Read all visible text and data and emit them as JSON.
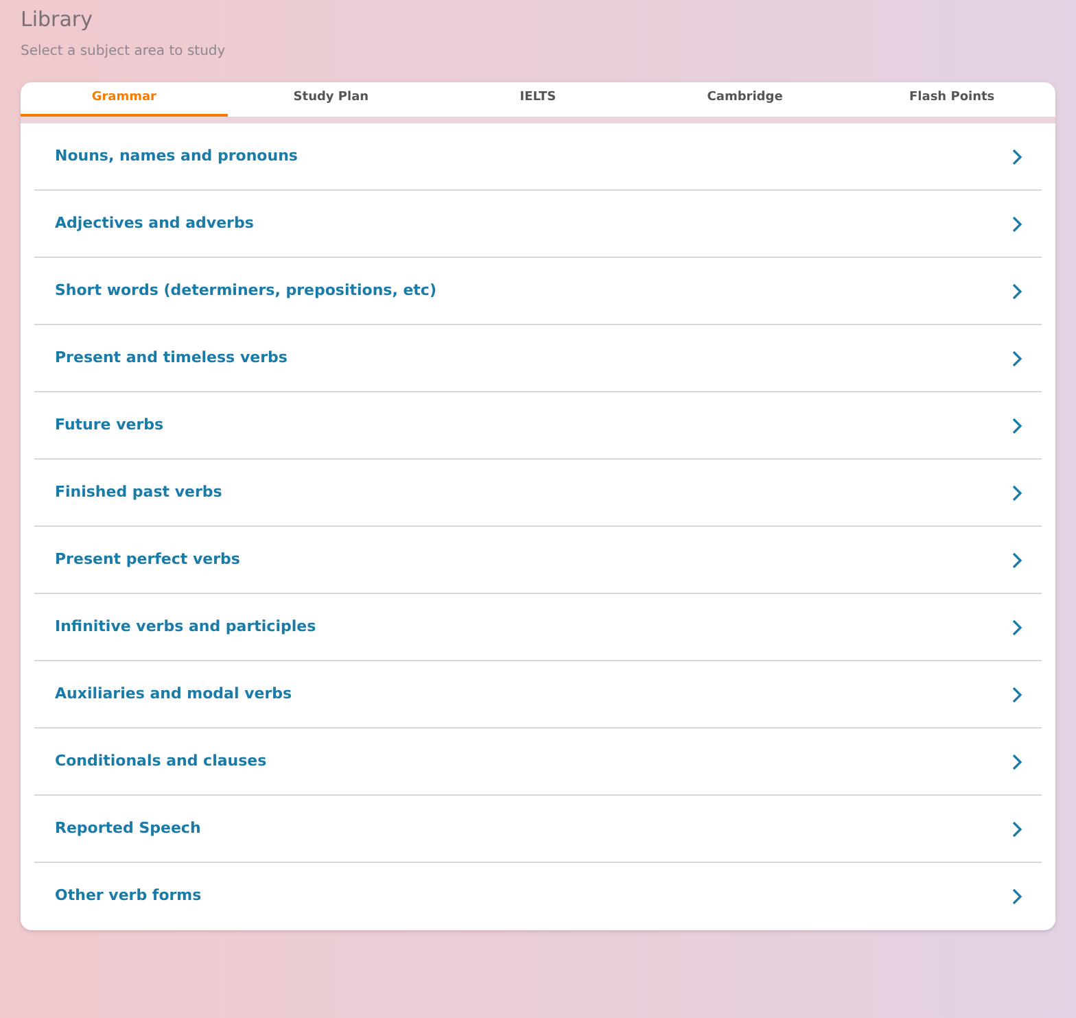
{
  "header": {
    "title": "Library",
    "subtitle": "Select a subject area to study"
  },
  "tabs": [
    {
      "label": "Grammar",
      "selected": true
    },
    {
      "label": "Study Plan",
      "selected": false
    },
    {
      "label": "IELTS",
      "selected": false
    },
    {
      "label": "Cambridge",
      "selected": false
    },
    {
      "label": "Flash Points",
      "selected": false
    }
  ],
  "topics": [
    {
      "label": "Nouns, names and pronouns"
    },
    {
      "label": "Adjectives and adverbs"
    },
    {
      "label": "Short words (determiners, prepositions, etc)"
    },
    {
      "label": "Present and timeless verbs"
    },
    {
      "label": "Future verbs"
    },
    {
      "label": "Finished past verbs"
    },
    {
      "label": "Present perfect verbs"
    },
    {
      "label": "Infinitive verbs and participles"
    },
    {
      "label": "Auxiliaries and modal verbs"
    },
    {
      "label": "Conditionals and clauses"
    },
    {
      "label": "Reported Speech"
    },
    {
      "label": "Other verb forms"
    }
  ]
}
